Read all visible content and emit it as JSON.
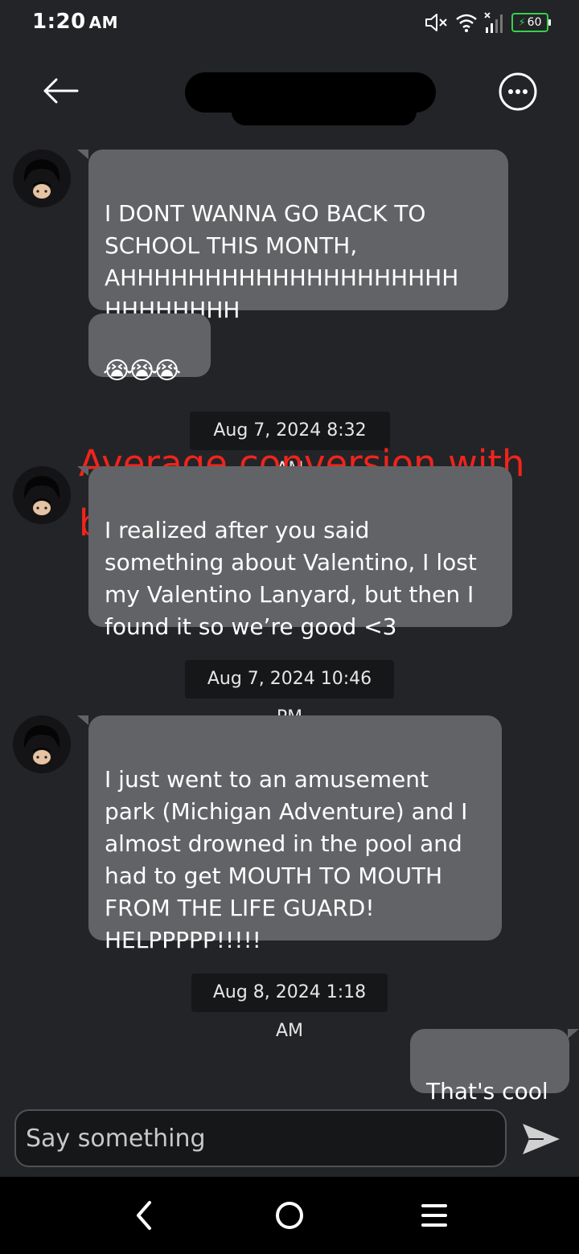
{
  "status_bar": {
    "time": "1:20",
    "ampm": "AM",
    "battery": "60",
    "mute_icon": "speaker-muted-icon",
    "wifi_icon": "wifi-icon",
    "signal_icon": "signal-bars-icon"
  },
  "header": {
    "back_icon": "arrow-left-icon",
    "more_icon": "more-horizontal-icon"
  },
  "messages": [
    {
      "text": "I DONT WANNA GO BACK TO\nSCHOOL THIS MONTH,\nAHHHHHHHHHHHHHHHHHHHH\nHHHHHHHH"
    },
    {
      "text": "😭😭😭"
    },
    {
      "text": "I realized after you said\nsomething about Valentino, I lost\nmy Valentino Lanyard, but then I\nfound it so we’re good <3"
    },
    {
      "text": "I just went to an amusement\npark (Michigan Adventure) and I\nalmost drowned in the pool and\nhad to get MOUTH TO MOUTH\nFROM THE LIFE GUARD!\nHELPPPPP!!!!!"
    },
    {
      "text": "That's cool"
    }
  ],
  "timestamps": [
    "Aug 7, 2024 8:32 AM",
    "Aug 7, 2024 10:46 PM",
    "Aug 8, 2024 1:18 AM"
  ],
  "overlay_caption": "Average conversion with\nbro",
  "composer": {
    "placeholder": "Say something",
    "send_icon": "send-icon"
  },
  "nav": {
    "back_icon": "nav-back-icon",
    "home_icon": "nav-home-icon",
    "menu_icon": "nav-menu-icon"
  },
  "colors": {
    "background": "#232427",
    "bubble": "#626366",
    "timestamp_bg": "#161719",
    "overlay_text": "#f0241c",
    "battery": "#35d14a"
  }
}
